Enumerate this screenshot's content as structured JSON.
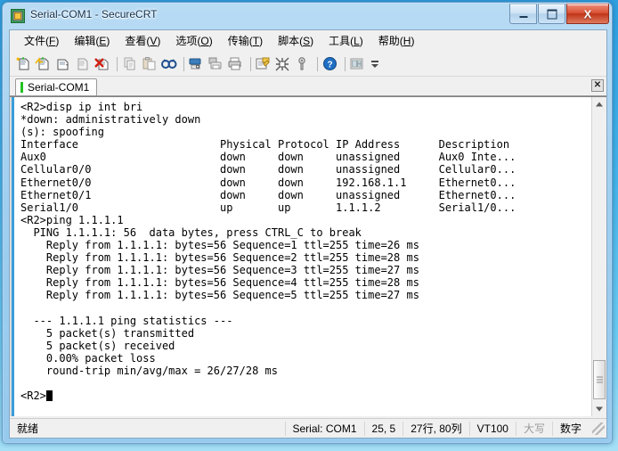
{
  "window": {
    "title": "Serial-COM1 - SecureCRT",
    "icon": "securecrt-app-icon",
    "minimize_label": "",
    "maximize_label": "",
    "close_label": "X"
  },
  "menubar": {
    "items": [
      {
        "name": "file",
        "pre": "文件(",
        "key": "F",
        "post": ")"
      },
      {
        "name": "edit",
        "pre": "编辑(",
        "key": "E",
        "post": ")"
      },
      {
        "name": "view",
        "pre": "查看(",
        "key": "V",
        "post": ")"
      },
      {
        "name": "options",
        "pre": "选项(",
        "key": "O",
        "post": ")"
      },
      {
        "name": "transfer",
        "pre": "传输(",
        "key": "T",
        "post": ")"
      },
      {
        "name": "script",
        "pre": "脚本(",
        "key": "S",
        "post": ")"
      },
      {
        "name": "tools",
        "pre": "工具(",
        "key": "L",
        "post": ")"
      },
      {
        "name": "help",
        "pre": "帮助(",
        "key": "H",
        "post": ")"
      }
    ]
  },
  "toolbar": {
    "icons": [
      "new-session-icon",
      "connect-session-icon",
      "clone-session-icon",
      "disconnect-icon",
      "disconnect-all-icon",
      "copy-icon",
      "paste-icon",
      "find-icon",
      "log-session-icon",
      "print-screen-icon",
      "print-icon",
      "session-options-icon",
      "session-manager-icon",
      "key-icon",
      "help-icon",
      "tile-windows-icon"
    ],
    "overflow_label": ""
  },
  "tabs": {
    "items": [
      {
        "label": "Serial-COM1",
        "active": true,
        "indicator_color": "#22c122"
      }
    ],
    "close_label": "✕"
  },
  "terminal": {
    "lines": [
      "<R2>disp ip int bri",
      "*down: administratively down",
      "(s): spoofing",
      "Interface                      Physical Protocol IP Address      Description",
      "Aux0                           down     down     unassigned      Aux0 Inte...",
      "Cellular0/0                    down     down     unassigned      Cellular0...",
      "Ethernet0/0                    down     down     192.168.1.1     Ethernet0...",
      "Ethernet0/1                    down     down     unassigned      Ethernet0...",
      "Serial1/0                      up       up       1.1.1.2         Serial1/0...",
      "<R2>ping 1.1.1.1",
      "  PING 1.1.1.1: 56  data bytes, press CTRL_C to break",
      "    Reply from 1.1.1.1: bytes=56 Sequence=1 ttl=255 time=26 ms",
      "    Reply from 1.1.1.1: bytes=56 Sequence=2 ttl=255 time=28 ms",
      "    Reply from 1.1.1.1: bytes=56 Sequence=3 ttl=255 time=27 ms",
      "    Reply from 1.1.1.1: bytes=56 Sequence=4 ttl=255 time=28 ms",
      "    Reply from 1.1.1.1: bytes=56 Sequence=5 ttl=255 time=27 ms",
      "",
      "  --- 1.1.1.1 ping statistics ---",
      "    5 packet(s) transmitted",
      "    5 packet(s) received",
      "    0.00% packet loss",
      "    round-trip min/avg/max = 26/27/28 ms",
      ""
    ],
    "prompt": "<R2>",
    "cursor": "block"
  },
  "statusbar": {
    "ready": "就绪",
    "connection": "Serial: COM1",
    "cursor_pos": "25,  5",
    "screen_size": "27行, 80列",
    "emulation": "VT100",
    "caps": "大写",
    "num": "数字"
  },
  "colors": {
    "accent": "#3a9ddb",
    "tab_indicator": "#22c122",
    "close_button": "#c03518",
    "terminal_bg": "#ffffff",
    "terminal_fg": "#000000",
    "chrome_bg": "#f0f0f0"
  }
}
